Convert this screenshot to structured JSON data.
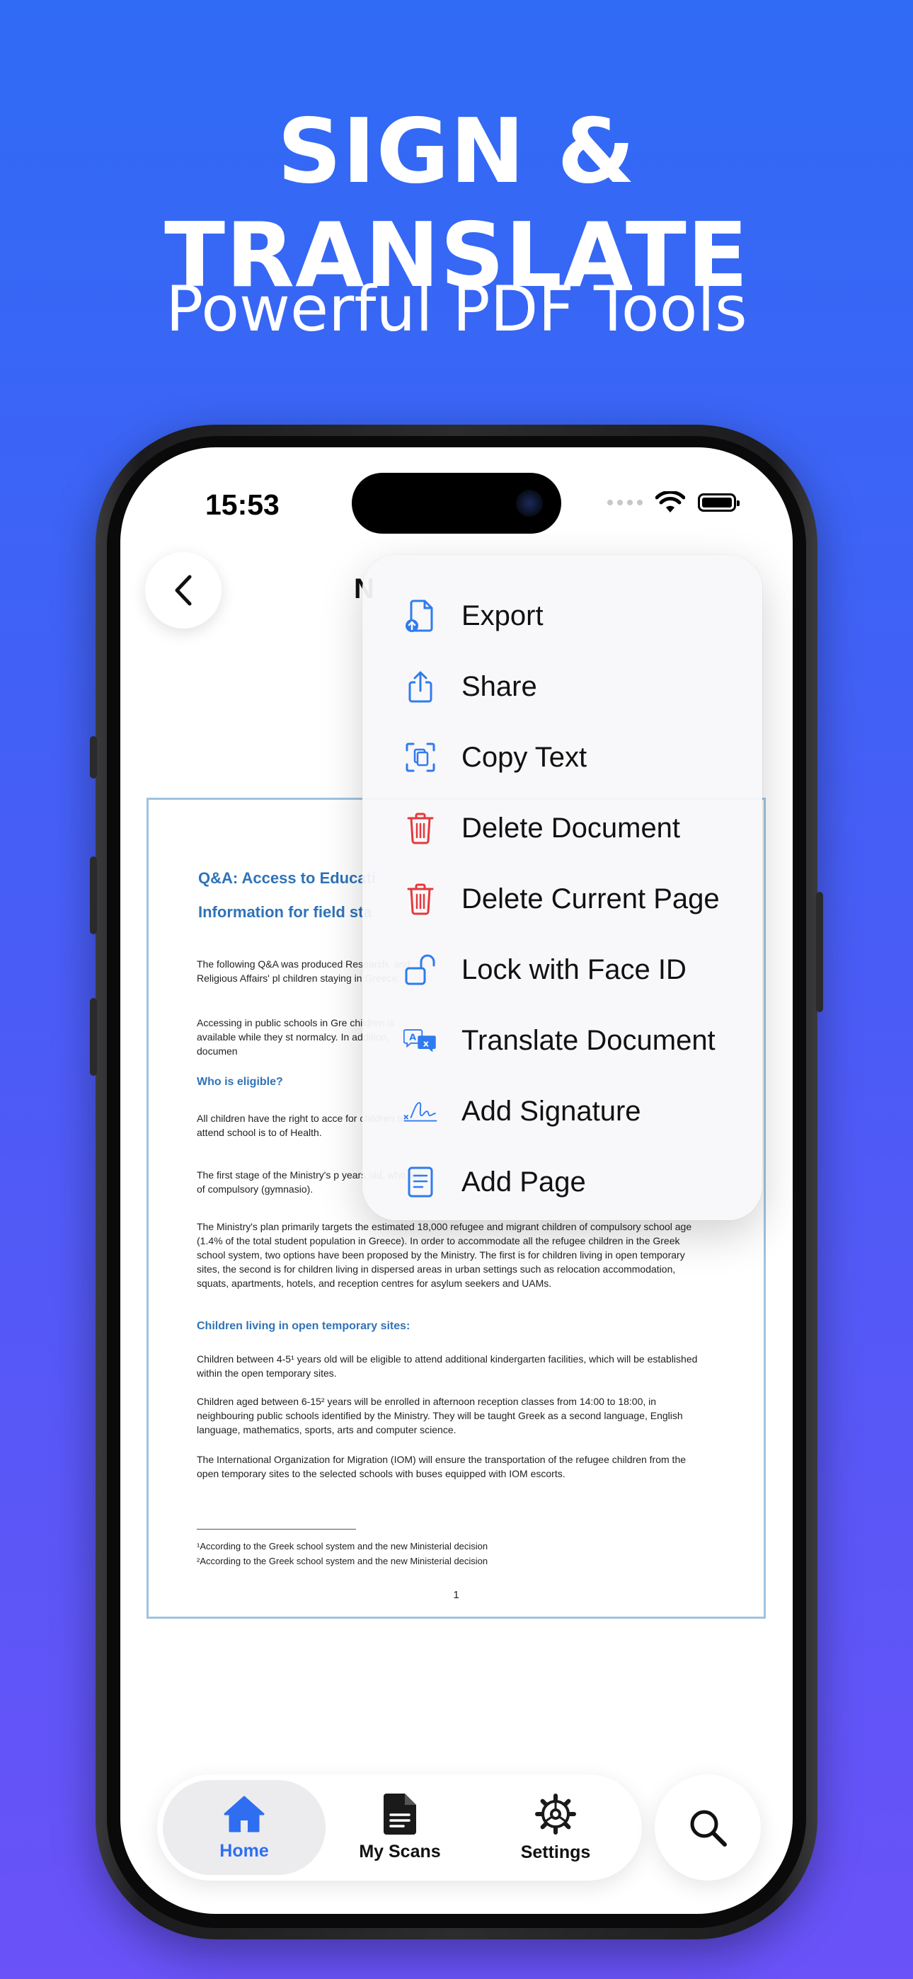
{
  "hero": {
    "headline": "SIGN & TRANSLATE",
    "subline": "Powerful PDF Tools"
  },
  "status_bar": {
    "time": "15:53"
  },
  "document": {
    "title": "N",
    "heading_line_1": "Q&A: Access to Educati",
    "heading_line_2": "Information for field sta",
    "para_1": "The following Q&A was produced Research, and Religious Affairs' pl children staying in Greece.",
    "para_2": "Accessing in public schools in Gre children is available while they st normalcy. In addition, documen",
    "section_1": "Who is eligible?",
    "para_3": "All children have the right to acce for children to attend school is to of Health.",
    "para_4": "The first stage of the Ministry's p years old, who are of compulsory (gymnasio).",
    "para_5": "The Ministry's plan primarily targets the estimated 18,000 refugee and migrant children of compulsory school age (1.4% of the total student population in Greece). In order to accommodate all the refugee children in the Greek school system, two options have been proposed by the Ministry. The first is for children living in open temporary sites, the second is for children living in dispersed areas in urban settings such as relocation accommodation, squats, apartments, hotels, and reception centres for asylum seekers and UAMs.",
    "section_2": "Children living in open temporary sites:",
    "para_6": "Children between 4-5¹ years old will be eligible to attend additional kindergarten facilities, which will be established within the open temporary sites.",
    "para_7": "Children aged between 6-15² years will be enrolled in afternoon reception classes from 14:00 to 18:00, in neighbouring public schools identified by the Ministry. They will be taught Greek as a second language, English language, mathematics, sports, arts and computer science.",
    "para_8": "The International Organization for Migration (IOM) will ensure the transportation of the refugee children from the open temporary sites to the selected schools with buses equipped with IOM escorts.",
    "footnote_1": "¹According to the Greek school system and the new Ministerial decision",
    "footnote_2": "²According to the Greek school system and the new Ministerial decision",
    "page_number": "1"
  },
  "menu": {
    "items": [
      {
        "label": "Export",
        "icon": "export-document-icon",
        "color": "#2F7BF0"
      },
      {
        "label": "Share",
        "icon": "share-icon",
        "color": "#2F7BF0"
      },
      {
        "label": "Copy Text",
        "icon": "copy-text-scan-icon",
        "color": "#2F7BF0"
      },
      {
        "label": "Delete Document",
        "icon": "trash-icon",
        "color": "#E5383B"
      },
      {
        "label": "Delete Current Page",
        "icon": "trash-icon",
        "color": "#E5383B"
      },
      {
        "label": "Lock with Face ID",
        "icon": "unlock-icon",
        "color": "#2F7BF0"
      },
      {
        "label": "Translate Document",
        "icon": "translate-icon",
        "color": "#2F7BF0"
      },
      {
        "label": "Add Signature",
        "icon": "signature-icon",
        "color": "#2F7BF0"
      },
      {
        "label": "Add Page",
        "icon": "add-page-icon",
        "color": "#2F7BF0"
      }
    ]
  },
  "tabbar": {
    "home": "Home",
    "scans": "My Scans",
    "settings": "Settings"
  },
  "colors": {
    "accent": "#2F6EF0",
    "destructive": "#E5383B",
    "background_top": "#2F6BF5",
    "background_bottom": "#6A52F8"
  }
}
